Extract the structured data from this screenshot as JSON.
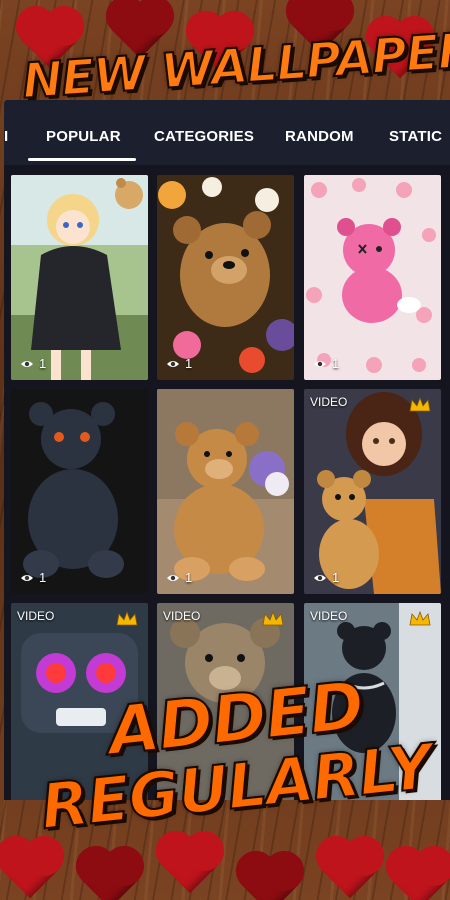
{
  "promo": {
    "headline_top": "NEW WALLPAPER",
    "headline_bottom_1": "ADDED",
    "headline_bottom_2": "REGULARLY"
  },
  "tabs": [
    {
      "label": "I",
      "active": false
    },
    {
      "label": "POPULAR",
      "active": true
    },
    {
      "label": "CATEGORIES",
      "active": false
    },
    {
      "label": "RANDOM",
      "active": false
    },
    {
      "label": "STATIC",
      "active": false
    }
  ],
  "wallpapers": [
    {
      "subject": "anime girl with teddy",
      "views": "1",
      "video_label": "",
      "premium": false
    },
    {
      "subject": "teddy bear with flowers",
      "views": "1",
      "video_label": "",
      "premium": false
    },
    {
      "subject": "pink teddy bear",
      "views": "1",
      "video_label": "",
      "premium": false
    },
    {
      "subject": "dark teddy bear",
      "views": "1",
      "video_label": "",
      "premium": false
    },
    {
      "subject": "teddy bear with lilacs",
      "views": "1",
      "video_label": "",
      "premium": false
    },
    {
      "subject": "girl hugging teddy",
      "views": "1",
      "video_label": "VIDEO",
      "premium": true
    },
    {
      "subject": "robot teddy",
      "views": "",
      "video_label": "VIDEO",
      "premium": true
    },
    {
      "subject": "plush teddy",
      "views": "",
      "video_label": "VIDEO",
      "premium": true
    },
    {
      "subject": "black teddy",
      "views": "",
      "video_label": "VIDEO",
      "premium": true
    }
  ],
  "colors": {
    "tab_bar": "#1c1f2e",
    "headline": "#ff6a00",
    "crown": "#f5b800",
    "hearts": "#c0141c"
  },
  "icons": {
    "views": "eye-icon",
    "premium": "crown-icon"
  }
}
